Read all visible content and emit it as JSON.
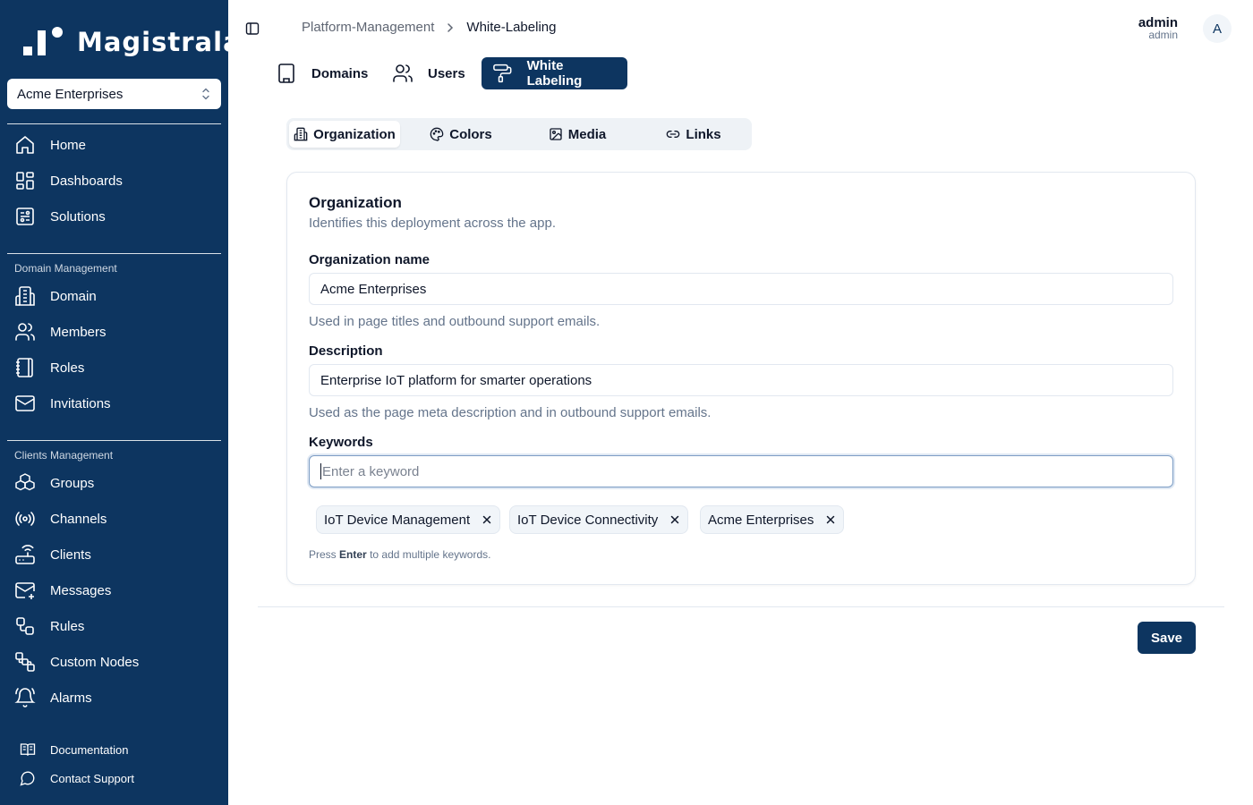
{
  "app": {
    "logo_text": "Magistrala"
  },
  "sidebar": {
    "org_selector": "Acme Enterprises",
    "main_items": [
      {
        "label": "Home",
        "icon": "home-icon"
      },
      {
        "label": "Dashboards",
        "icon": "dashboard-icon"
      },
      {
        "label": "Solutions",
        "icon": "solutions-icon"
      }
    ],
    "domain_section_title": "Domain Management",
    "domain_items": [
      {
        "label": "Domain",
        "icon": "building-icon"
      },
      {
        "label": "Members",
        "icon": "users-icon"
      },
      {
        "label": "Roles",
        "icon": "notebook-icon"
      },
      {
        "label": "Invitations",
        "icon": "mail-icon"
      }
    ],
    "clients_section_title": "Clients Management",
    "clients_items": [
      {
        "label": "Groups",
        "icon": "boxes-icon"
      },
      {
        "label": "Channels",
        "icon": "radio-icon"
      },
      {
        "label": "Clients",
        "icon": "router-icon"
      },
      {
        "label": "Messages",
        "icon": "mail-open-icon"
      },
      {
        "label": "Rules",
        "icon": "workflow-icon"
      },
      {
        "label": "Custom Nodes",
        "icon": "nodes-icon"
      },
      {
        "label": "Alarms",
        "icon": "bell-icon"
      }
    ],
    "footer_items": [
      {
        "label": "Documentation",
        "icon": "book-icon"
      },
      {
        "label": "Contact Support",
        "icon": "chat-icon"
      }
    ]
  },
  "header": {
    "breadcrumb_parent": "Platform-Management",
    "breadcrumb_current": "White-Labeling",
    "user_name": "admin",
    "user_role": "admin",
    "avatar_initial": "A"
  },
  "top_tabs": [
    {
      "label": "Domains",
      "active": false
    },
    {
      "label": "Users",
      "active": false
    },
    {
      "label": "White Labeling",
      "active": true
    }
  ],
  "sub_tabs": [
    {
      "label": "Organization",
      "active": true
    },
    {
      "label": "Colors",
      "active": false
    },
    {
      "label": "Media",
      "active": false
    },
    {
      "label": "Links",
      "active": false
    }
  ],
  "card": {
    "title": "Organization",
    "description": "Identifies this deployment across the app.",
    "org_name_label": "Organization name",
    "org_name_value": "Acme Enterprises",
    "org_name_help": "Used in page titles and outbound support emails.",
    "description_label": "Description",
    "description_value": "Enterprise IoT platform for smarter operations",
    "description_help": "Used as the page meta description and in outbound support emails.",
    "keywords_label": "Keywords",
    "keywords_placeholder": "Enter a keyword",
    "keywords": [
      "IoT Device Management",
      "IoT Device Connectivity",
      "Acme Enterprises"
    ],
    "hint_prefix": "Press",
    "hint_key": "Enter",
    "hint_suffix": "to add multiple keywords."
  },
  "actions": {
    "save_label": "Save"
  },
  "colors": {
    "primary": "#0d3560",
    "muted_text": "#64748b",
    "border": "#e2e8f0"
  }
}
